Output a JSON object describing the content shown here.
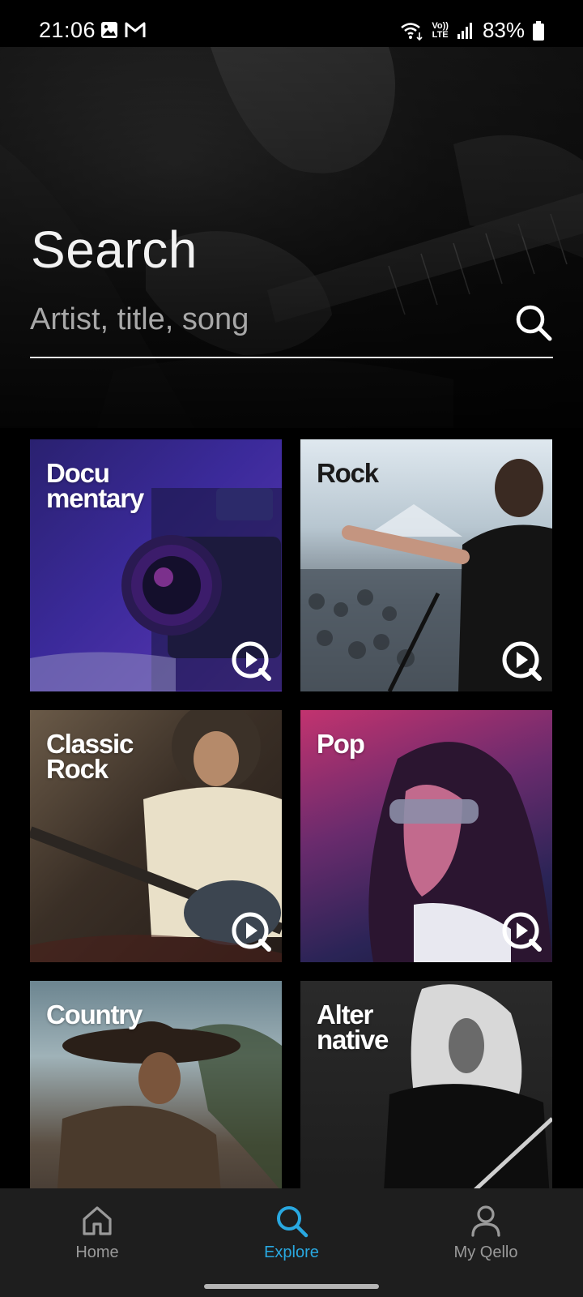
{
  "status_bar": {
    "time": "21:06",
    "left_icons": [
      "gallery-icon",
      "gmail-icon"
    ],
    "right_icons": [
      "wifi-icon",
      "volte-icon",
      "signal-icon",
      "battery-icon"
    ],
    "volte_label_top": "Vo))",
    "volte_label_bottom": "LTE",
    "battery": "83%"
  },
  "search": {
    "title": "Search",
    "placeholder": "Artist, title, song",
    "value": "",
    "icon": "search-icon"
  },
  "genres": [
    {
      "label": "Docu\nmentary",
      "badge_icon": "play-icon",
      "accent": "#3b2a9a"
    },
    {
      "label": "Rock",
      "badge_icon": "play-icon",
      "accent": "#b7c6d0"
    },
    {
      "label": "Classic\nRock",
      "badge_icon": "play-icon",
      "accent": "#6a5a48"
    },
    {
      "label": "Pop",
      "badge_icon": "play-icon",
      "accent": "#c2336f"
    },
    {
      "label": "Country",
      "badge_icon": "play-icon",
      "accent": "#6c8590"
    },
    {
      "label": "Alter\nnative",
      "badge_icon": "play-icon",
      "accent": "#2a2a2a"
    }
  ],
  "bottom_nav": {
    "items": [
      {
        "label": "Home",
        "icon": "home-icon",
        "active": false
      },
      {
        "label": "Explore",
        "icon": "search-icon",
        "active": true
      },
      {
        "label": "My Qello",
        "icon": "user-icon",
        "active": false
      }
    ],
    "active_color": "#29a8e0",
    "inactive_color": "#9a9a9a"
  }
}
